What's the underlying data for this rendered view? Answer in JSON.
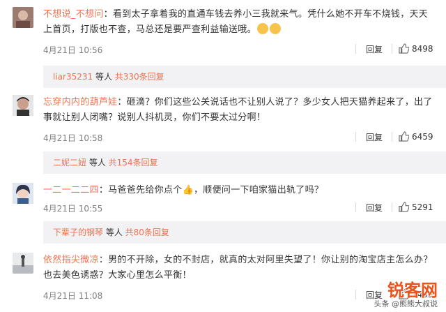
{
  "comments": [
    {
      "username": "不想说_不想问",
      "text": "：看到太子拿着我的直通车钱去养小三我就来气。凭什么她不开车不烧钱，天天上首页，打版也不查，马总还是要严查利益输送哦。",
      "time": "4月21日 10:56",
      "reply_label": "回复",
      "likes": "8498",
      "reply_summary": {
        "user": "liar35231",
        "middle": " 等人 ",
        "link": "共330条回复"
      },
      "avatar_color": "#8a6e68"
    },
    {
      "username": "忘穿内内的葫芦娃",
      "text": "：砸滴？你们这些公关说话也不让别人说了？多少女人把天猫养起来了，出了事就让别人闭嘴？说别人抖机灵，你们不要太过分啊！",
      "time": "4月21日 10:58",
      "reply_label": "回复",
      "likes": "6459",
      "reply_summary": {
        "user": "二妮二妞",
        "middle": " 等人 ",
        "link": "共154条回复"
      },
      "avatar_color": "#3b3b3b"
    },
    {
      "username": "一二一二二四",
      "text": "：马爸爸先给你点个👍，顺便问一下咱家猫出轨了吗？",
      "time": "4月21日 10:55",
      "reply_label": "回复",
      "likes": "5291",
      "reply_summary": {
        "user": "下辈子的钢琴",
        "middle": " 等人 ",
        "link": "共80条回复"
      },
      "avatar_color": "#4a5a7a"
    },
    {
      "username": "依然指尖微凉",
      "text": "：男的不开除，女的不封店，就真的太对阿里失望了！你让别的淘宝店主怎么办？也去美色诱惑？大家心里怎么平衡！",
      "time": "4月21日 11:08",
      "reply_label": "回复",
      "likes": "1463",
      "avatar_color": "#c9c9c9"
    }
  ],
  "watermark": {
    "main": "锐客网",
    "sub": "头条 @熊熊大叔说"
  }
}
